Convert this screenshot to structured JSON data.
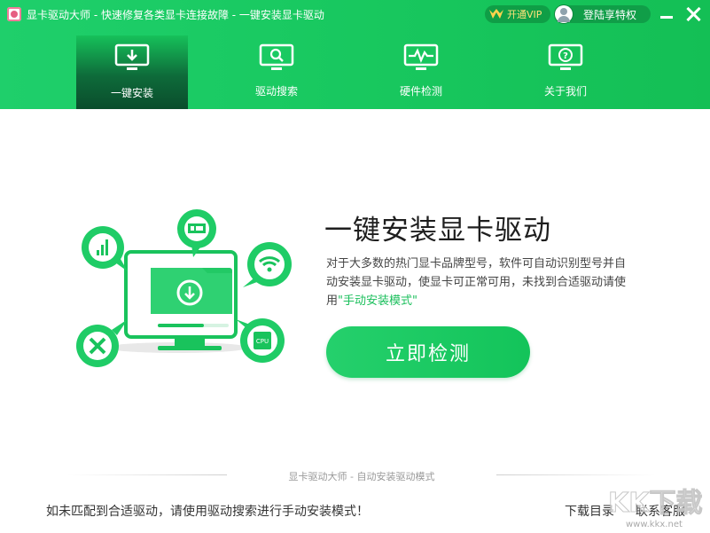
{
  "app": {
    "title": "显卡驱动大师 - 快速修复各类显卡连接故障 - 一键安装显卡驱动",
    "vip_label": "开通VIP",
    "login_label": "登陆享特权"
  },
  "nav": {
    "tabs": [
      {
        "label": "一键安装",
        "icon": "download-monitor-icon",
        "active": true
      },
      {
        "label": "驱动搜索",
        "icon": "search-monitor-icon",
        "active": false
      },
      {
        "label": "硬件检测",
        "icon": "pulse-monitor-icon",
        "active": false
      },
      {
        "label": "关于我们",
        "icon": "question-monitor-icon",
        "active": false
      }
    ]
  },
  "main": {
    "heading": "一键安装显卡驱动",
    "description": "对于大多数的热门显卡品牌型号，软件可自动识别型号并自动安装显卡驱动，使显卡可正常可用，未找到合适驱动请使用",
    "manual_link": "\"手动安装模式\"",
    "detect_button": "立即检测",
    "illustration_bubbles": [
      "chart-bubble-icon",
      "gpu-card-bubble-icon",
      "wifi-bubble-icon",
      "tools-bubble-icon",
      "cpu-bubble-icon"
    ],
    "cpu_label": "CPU"
  },
  "footer": {
    "caption": "显卡驱动大师 - 自动安装驱动模式",
    "hint": "如未匹配到合适驱动，请使用驱动搜索进行手动安装模式！",
    "download_dir": "下载目录",
    "contact": "联系客服"
  },
  "watermark": {
    "text": "KK下载",
    "url": "www.kkx.net"
  },
  "colors": {
    "brand_green": "#18c85f",
    "active_tab_dark": "#0a4d2c",
    "link_green": "#1bbf5c",
    "vip_gold": "#ffd34d"
  }
}
